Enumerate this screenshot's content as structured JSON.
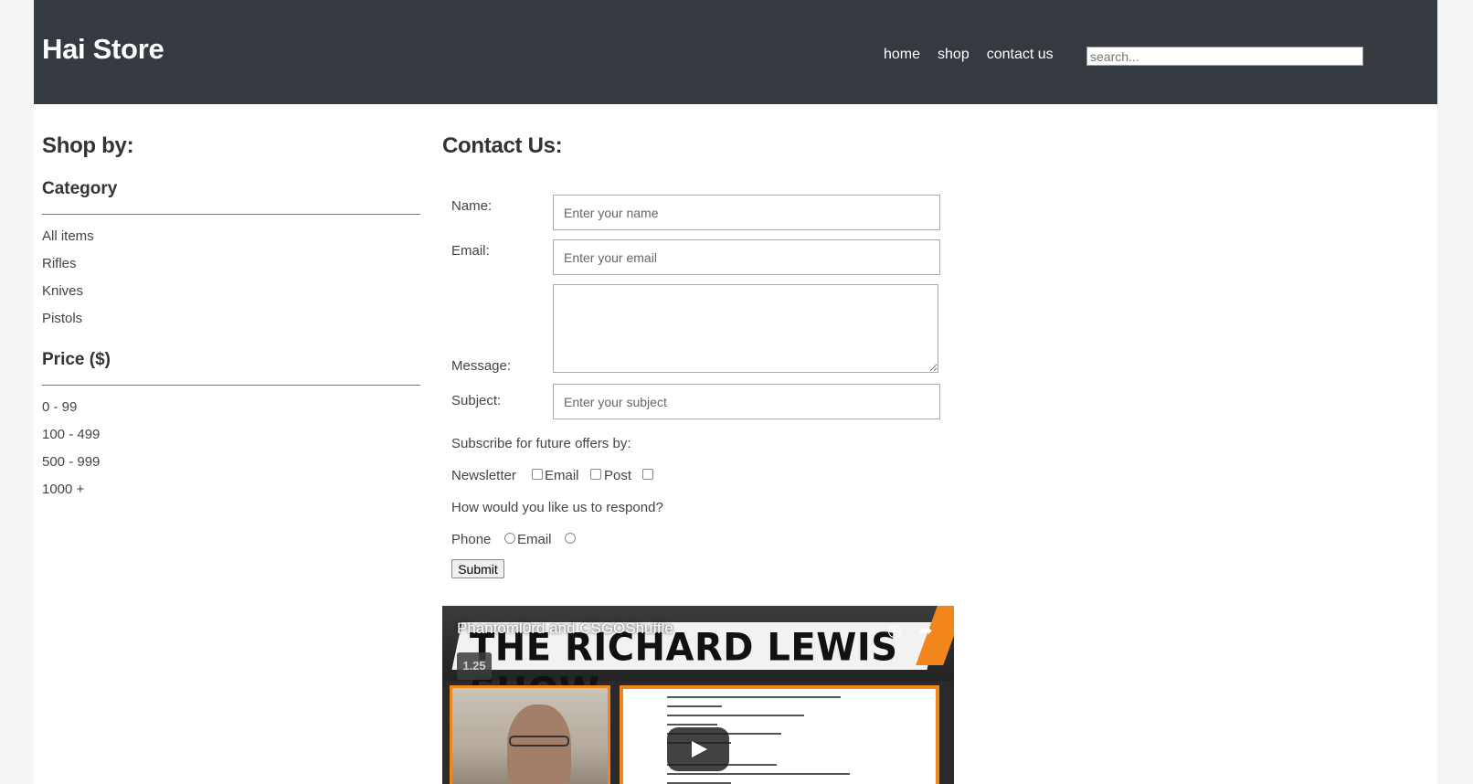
{
  "header": {
    "brand": "Hai Store",
    "nav": [
      "home",
      "shop",
      "contact us"
    ],
    "search_placeholder": "search..."
  },
  "sidebar": {
    "title": "Shop by:",
    "category_heading": "Category",
    "categories": [
      "All items",
      "Rifles",
      "Knives",
      "Pistols"
    ],
    "price_heading": "Price ($)",
    "prices": [
      "0 - 99",
      "100 - 499",
      "500 - 999",
      "1000 +"
    ]
  },
  "contact": {
    "title": "Contact Us:",
    "name_label": "Name:",
    "name_placeholder": "Enter your name",
    "email_label": "Email:",
    "email_placeholder": "Enter your email",
    "message_label": "Message:",
    "subject_label": "Subject:",
    "subject_placeholder": "Enter your subject",
    "subscribe_label": "Subscribe for future offers by:",
    "subscribe_options": [
      "Newsletter",
      "Email",
      "Post"
    ],
    "respond_label": "How would you like us to respond?",
    "respond_options": [
      "Phone",
      "Email"
    ],
    "submit_label": "Submit"
  },
  "video": {
    "title": "Phantoml0rd and CSGOShuffle",
    "banner_text": "THE RICHARD LEWIS SHOW",
    "speed": "1.25"
  },
  "colors": {
    "header_bg": "#343a40",
    "accent_orange": "#f0861c"
  }
}
